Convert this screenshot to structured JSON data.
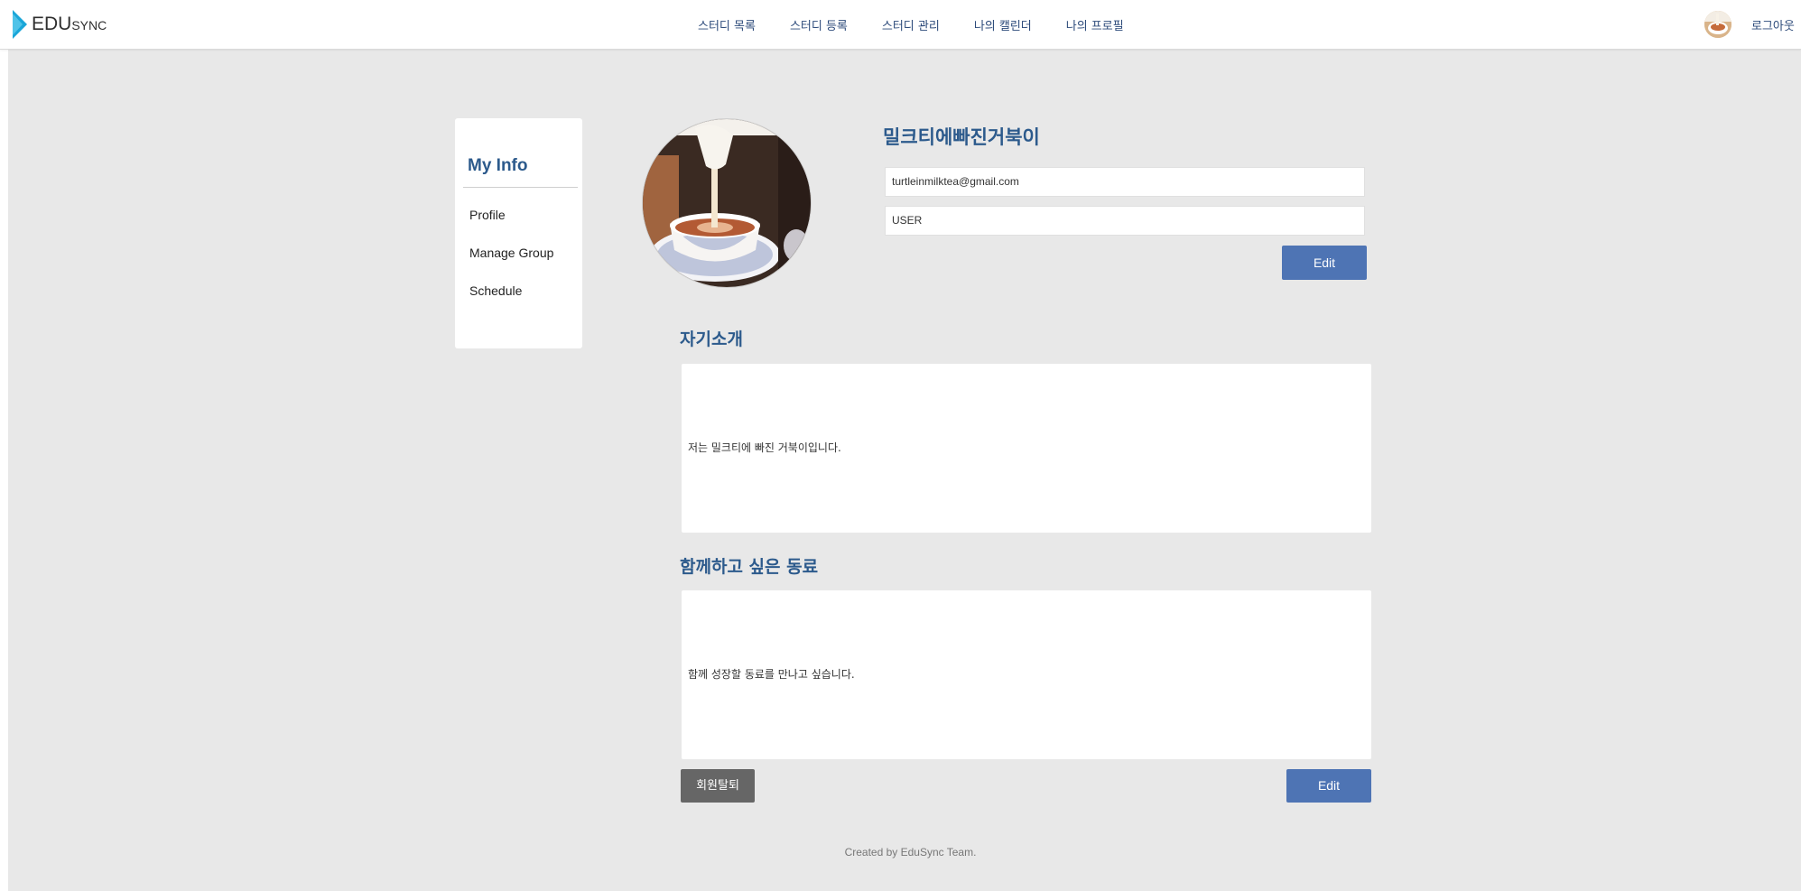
{
  "header": {
    "logo": {
      "big": "EDU",
      "small": "SYNC"
    },
    "nav": [
      "스터디 목록",
      "스터디 등록",
      "스터디 관리",
      "나의 캘린더",
      "나의 프로필"
    ],
    "logout_label": "로그아웃"
  },
  "sidebar": {
    "title": "My Info",
    "items": [
      "Profile",
      "Manage Group",
      "Schedule"
    ]
  },
  "profile": {
    "nickname": "밀크티에빠진거북이",
    "email": "turtleinmilktea@gmail.com",
    "role": "USER",
    "edit_label": "Edit"
  },
  "intro": {
    "title": "자기소개",
    "text": "저는 밀크티에 빠진 거북이입니다."
  },
  "peer": {
    "title": "함께하고 싶은 동료",
    "text": "함께 성장할 동료를 만나고 싶습니다."
  },
  "actions": {
    "withdraw_label": "회원탈퇴",
    "edit_label": "Edit"
  },
  "footer": {
    "text": "Created by EduSync Team."
  },
  "colors": {
    "accent": "#4e74b4",
    "title": "#2c5a8c",
    "nav": "#2c4a7a",
    "withdraw": "#666666"
  },
  "icons": {
    "logo": "edusync-play-logo-icon",
    "avatar": "milk-tea-avatar",
    "photo": "milk-tea-profile-photo"
  }
}
